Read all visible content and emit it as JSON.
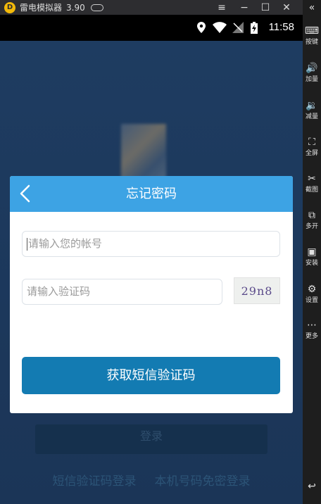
{
  "window": {
    "app_title": "雷电模拟器",
    "version": "3.90",
    "logo_glyph": "D"
  },
  "status_bar": {
    "time": "11:58"
  },
  "sidebar": {
    "collapse_glyph": "«",
    "items": [
      {
        "label": "按键",
        "icon": "keyboard-icon",
        "glyph": "⌨"
      },
      {
        "label": "加量",
        "icon": "volume-up-icon",
        "glyph": "🔊"
      },
      {
        "label": "减量",
        "icon": "volume-down-icon",
        "glyph": "🔉"
      },
      {
        "label": "全屏",
        "icon": "fullscreen-icon",
        "glyph": "⛶"
      },
      {
        "label": "截图",
        "icon": "scissors-icon",
        "glyph": "✂"
      },
      {
        "label": "多开",
        "icon": "multi-instance-icon",
        "glyph": "⧉"
      },
      {
        "label": "安装",
        "icon": "apk-install-icon",
        "glyph": "▣"
      },
      {
        "label": "设置",
        "icon": "gear-icon",
        "glyph": "⚙"
      },
      {
        "label": "更多",
        "icon": "more-icon",
        "glyph": "⋯"
      }
    ],
    "back_glyph": "↩"
  },
  "dialog": {
    "title": "忘记密码",
    "account_placeholder": "请输入您的帐号",
    "code_placeholder": "请输入验证码",
    "captcha_text": "29n8",
    "submit_label": "获取短信验证码"
  },
  "background": {
    "login_label": "登录",
    "links": [
      "短信验证码登录",
      "本机号码免密登录"
    ]
  },
  "colors": {
    "dialog_header": "#3da3e4",
    "submit_button": "#137bb2",
    "app_background": "#1e3c61"
  }
}
